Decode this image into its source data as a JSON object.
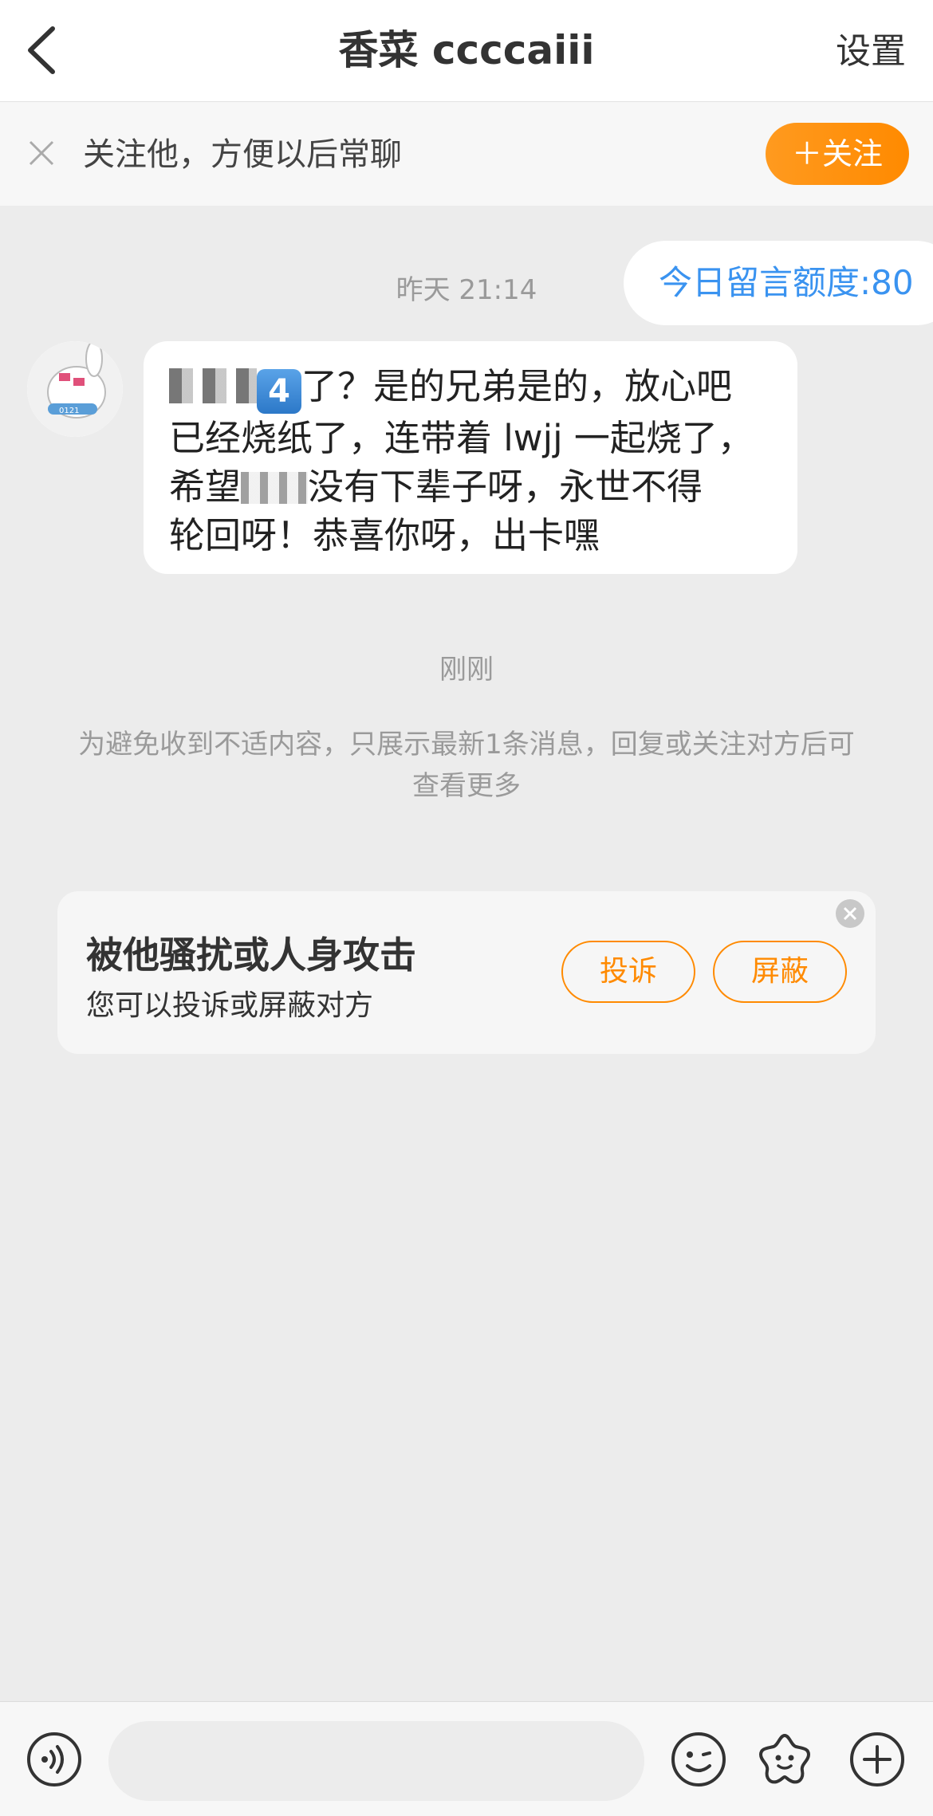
{
  "header": {
    "title": "香菜 ccccaiii",
    "settings_label": "设置"
  },
  "follow_bar": {
    "text": "关注他，方便以后常聊",
    "follow_button": "＋关注"
  },
  "chat": {
    "quota_text": "今日留言额度:80",
    "time_1": "昨天 21:14",
    "message": {
      "number_badge": "4",
      "line1_rest": "了？是的兄弟是的，放心吧",
      "line2": "已经烧纸了，连带着 lwjj 一起烧了，",
      "line3_start": "希望",
      "line3_rest": "没有下辈子呀，永世不得",
      "line4": "轮回呀！恭喜你呀，出卡嘿"
    },
    "time_2": "刚刚",
    "notice": "为避免收到不适内容，只展示最新1条消息，回复或关注对方后可查看更多"
  },
  "report_card": {
    "title": "被他骚扰或人身攻击",
    "subtitle": "您可以投诉或屏蔽对方",
    "report_button": "投诉",
    "block_button": "屏蔽"
  },
  "toolbar": {
    "input_value": "",
    "icons": [
      "voice-icon",
      "emoji-icon",
      "sticker-icon",
      "plus-icon"
    ]
  },
  "colors": {
    "accent_orange": "#ff8a00",
    "link_blue": "#3a93f0",
    "background": "#ececec"
  }
}
